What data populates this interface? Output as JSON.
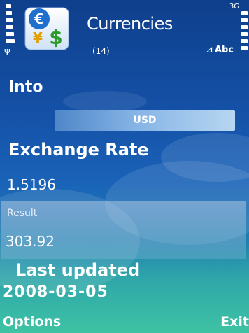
{
  "status_bar": {
    "network_label": "3G",
    "antenna_icon": "antenna-icon",
    "input_mode": "Abc",
    "input_mode_icon": "pencil-arrow-icon"
  },
  "app": {
    "title": "Currencies",
    "count": "(14)",
    "icon": "currency-exchange-icon"
  },
  "form": {
    "into_label": "Into",
    "into_value": "USD",
    "exchange_rate_label": "Exchange Rate",
    "exchange_rate_value": "1.5196",
    "result_label": "Result",
    "result_value": "303.92",
    "last_updated_label": "Last updated",
    "last_updated_value": "2008-03-05"
  },
  "softkeys": {
    "left": "Options",
    "right": "Exit"
  },
  "colors": {
    "background_top": "#0e3f8c",
    "background_bottom": "#3ec3a4",
    "text": "#ffffff"
  }
}
